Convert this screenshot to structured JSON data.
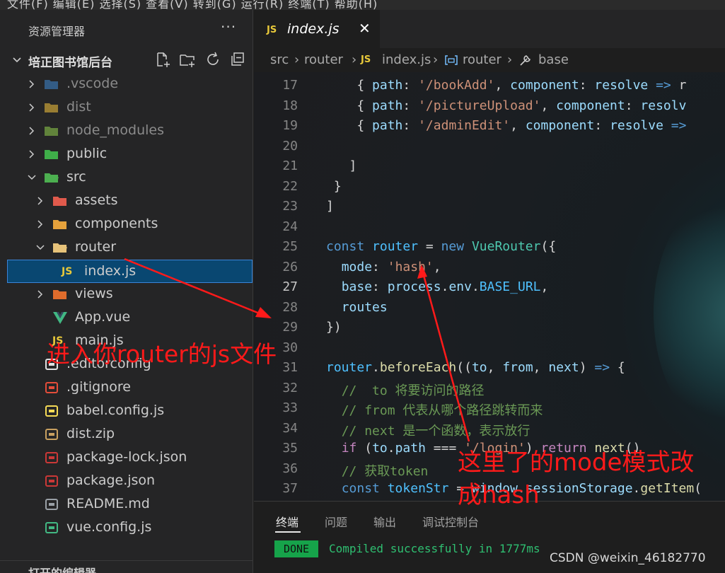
{
  "menubar": {
    "text": "文件(F)   编辑(E)   选择(S)   查看(V)   转到(G)   运行(R)   终端(T)   帮助(H)"
  },
  "sidebar": {
    "title": "资源管理器",
    "more": "···",
    "project_name": "培正图书馆后台",
    "items": [
      {
        "label": "vscode-folder",
        "name": ".vscode",
        "depth": 0,
        "chevron": "right",
        "icon": "vscode-folder-icon",
        "dim": true
      },
      {
        "label": "dist-folder",
        "name": "dist",
        "depth": 0,
        "chevron": "right",
        "icon": "dist-folder-icon",
        "dim": true
      },
      {
        "label": "node-modules-folder",
        "name": "node_modules",
        "depth": 0,
        "chevron": "right",
        "icon": "node-folder-icon",
        "dim": true
      },
      {
        "label": "public-folder",
        "name": "public",
        "depth": 0,
        "chevron": "right",
        "icon": "public-folder-icon",
        "dim": false
      },
      {
        "label": "src-folder",
        "name": "src",
        "depth": 0,
        "chevron": "down",
        "icon": "src-folder-icon",
        "dim": false
      },
      {
        "label": "assets-folder",
        "name": "assets",
        "depth": 1,
        "chevron": "right",
        "icon": "assets-folder-icon",
        "dim": false
      },
      {
        "label": "components-folder",
        "name": "components",
        "depth": 1,
        "chevron": "right",
        "icon": "components-folder-icon",
        "dim": false
      },
      {
        "label": "router-folder",
        "name": "router",
        "depth": 1,
        "chevron": "down",
        "icon": "router-folder-icon",
        "dim": false
      },
      {
        "label": "index-js-file",
        "name": "index.js",
        "depth": 2,
        "chevron": "none",
        "icon": "js-file-icon",
        "dim": false,
        "selected": true
      },
      {
        "label": "views-folder",
        "name": "views",
        "depth": 1,
        "chevron": "right",
        "icon": "views-folder-icon",
        "dim": false
      },
      {
        "label": "app-vue-file",
        "name": "App.vue",
        "depth": 1,
        "chevron": "none",
        "icon": "vue-file-icon",
        "dim": false
      },
      {
        "label": "main-js-file",
        "name": "main.js",
        "depth": 1,
        "chevron": "none",
        "icon": "js-file-icon",
        "dim": false
      },
      {
        "label": "editorconfig-file",
        "name": ".editorconfig",
        "depth": 0,
        "chevron": "none",
        "icon": "editorconfig-icon",
        "dim": false
      },
      {
        "label": "gitignore-file",
        "name": ".gitignore",
        "depth": 0,
        "chevron": "none",
        "icon": "git-icon",
        "dim": false
      },
      {
        "label": "babel-config-file",
        "name": "babel.config.js",
        "depth": 0,
        "chevron": "none",
        "icon": "babel-icon",
        "dim": false
      },
      {
        "label": "dist-zip-file",
        "name": "dist.zip",
        "depth": 0,
        "chevron": "none",
        "icon": "zip-icon",
        "dim": false
      },
      {
        "label": "package-lock-file",
        "name": "package-lock.json",
        "depth": 0,
        "chevron": "none",
        "icon": "npm-icon",
        "dim": false
      },
      {
        "label": "package-json-file",
        "name": "package.json",
        "depth": 0,
        "chevron": "none",
        "icon": "npm-icon",
        "dim": false
      },
      {
        "label": "readme-file",
        "name": "README.md",
        "depth": 0,
        "chevron": "none",
        "icon": "markdown-icon",
        "dim": false
      },
      {
        "label": "vue-config-file",
        "name": "vue.config.js",
        "depth": 0,
        "chevron": "none",
        "icon": "vue-config-icon",
        "dim": false
      }
    ],
    "bottom_section": "打开的编辑器"
  },
  "tab": {
    "badge": "JS",
    "name": "index.js",
    "close": "✕"
  },
  "breadcrumb": {
    "src": "src",
    "sep": "›",
    "router": "router",
    "badge": "JS",
    "file": "index.js",
    "sym_router": "router",
    "sym_base": "base"
  },
  "code": {
    "active_line": 27,
    "lines": [
      {
        "n": 17,
        "html": "    <span class=\"p\">{ </span><span class=\"prop\">path</span><span class=\"p\">: </span><span class=\"str\">'/bookAdd'</span><span class=\"p\">, </span><span class=\"prop\">component</span><span class=\"p\">: </span><span class=\"var\">resolve</span><span class=\"p\"> </span><span class=\"kw\">=&gt;</span><span class=\"p\"> r</span>"
      },
      {
        "n": 18,
        "html": "    <span class=\"p\">{ </span><span class=\"prop\">path</span><span class=\"p\">: </span><span class=\"str\">'/pictureUpload'</span><span class=\"p\">, </span><span class=\"prop\">component</span><span class=\"p\">: </span><span class=\"var\">resolv</span>"
      },
      {
        "n": 19,
        "html": "    <span class=\"p\">{ </span><span class=\"prop\">path</span><span class=\"p\">: </span><span class=\"str\">'/adminEdit'</span><span class=\"p\">, </span><span class=\"prop\">component</span><span class=\"p\">: </span><span class=\"var\">resolve</span><span class=\"p\"> </span><span class=\"kw\">=&gt;</span>"
      },
      {
        "n": 20,
        "html": ""
      },
      {
        "n": 21,
        "html": "   <span class=\"p\">]</span>"
      },
      {
        "n": 22,
        "html": " <span class=\"p\">}</span>"
      },
      {
        "n": 23,
        "html": "<span class=\"p\">]</span>"
      },
      {
        "n": 24,
        "html": ""
      },
      {
        "n": 25,
        "html": "<span class=\"kw\">const</span> <span class=\"const\">router</span> <span class=\"p\">=</span> <span class=\"kw\">new</span> <span class=\"cls\">VueRouter</span><span class=\"p\">({</span>"
      },
      {
        "n": 26,
        "html": "  <span class=\"prop\">mode</span><span class=\"p\">: </span><span class=\"str\">'hash'</span><span class=\"p\">,</span>"
      },
      {
        "n": 27,
        "html": "  <span class=\"prop\">base</span><span class=\"p\">: </span><span class=\"var\">process</span><span class=\"p\">.</span><span class=\"var\">env</span><span class=\"p\">.</span><span class=\"const\">BASE_URL</span><span class=\"p\">,</span>"
      },
      {
        "n": 28,
        "html": "  <span class=\"prop\">routes</span>"
      },
      {
        "n": 29,
        "html": "<span class=\"p\">})</span>"
      },
      {
        "n": 30,
        "html": ""
      },
      {
        "n": 31,
        "html": "<span class=\"const\">router</span><span class=\"p\">.</span><span class=\"fn\">beforeEach</span><span class=\"p\">((</span><span class=\"var\">to</span><span class=\"p\">, </span><span class=\"var\">from</span><span class=\"p\">, </span><span class=\"var\">next</span><span class=\"p\">) </span><span class=\"kw\">=&gt;</span><span class=\"p\"> {</span>"
      },
      {
        "n": 32,
        "html": "  <span class=\"cm\">//  to 将要访问的路径</span>"
      },
      {
        "n": 33,
        "html": "  <span class=\"cm\">// from 代表从哪个路径跳转而来</span>"
      },
      {
        "n": 34,
        "html": "  <span class=\"cm\">// next 是一个函数，表示放行</span>"
      },
      {
        "n": 35,
        "html": "  <span class=\"ctl\">if</span><span class=\"p\"> (</span><span class=\"var\">to</span><span class=\"p\">.</span><span class=\"var\">path</span><span class=\"p\"> === </span><span class=\"str\">'/login'</span><span class=\"p\">) </span><span class=\"ctl\">return</span><span class=\"p\"> </span><span class=\"fn\">next</span><span class=\"p\">()</span>"
      },
      {
        "n": 36,
        "html": "  <span class=\"cm\">// 获取token</span>"
      },
      {
        "n": 37,
        "html": "  <span class=\"kw\">const</span> <span class=\"const\">tokenStr</span><span class=\"p\"> = </span><span class=\"var\">window</span><span class=\"p\">.</span><span class=\"var\">sessionStorage</span><span class=\"p\">.</span><span class=\"fn\">getItem</span><span class=\"p\">(</span>"
      }
    ]
  },
  "panel": {
    "tabs": [
      "终端",
      "问题",
      "输出",
      "调试控制台"
    ],
    "done": "DONE",
    "compiled": "Compiled successfully in 1777ms"
  },
  "watermark": "CSDN @weixin_46182770",
  "annotations": {
    "left_note": "进入你router的js文件",
    "right_note_line1": "这里了的mode模式改",
    "right_note_line2": "成hash",
    "color": "#ff1a1a"
  }
}
